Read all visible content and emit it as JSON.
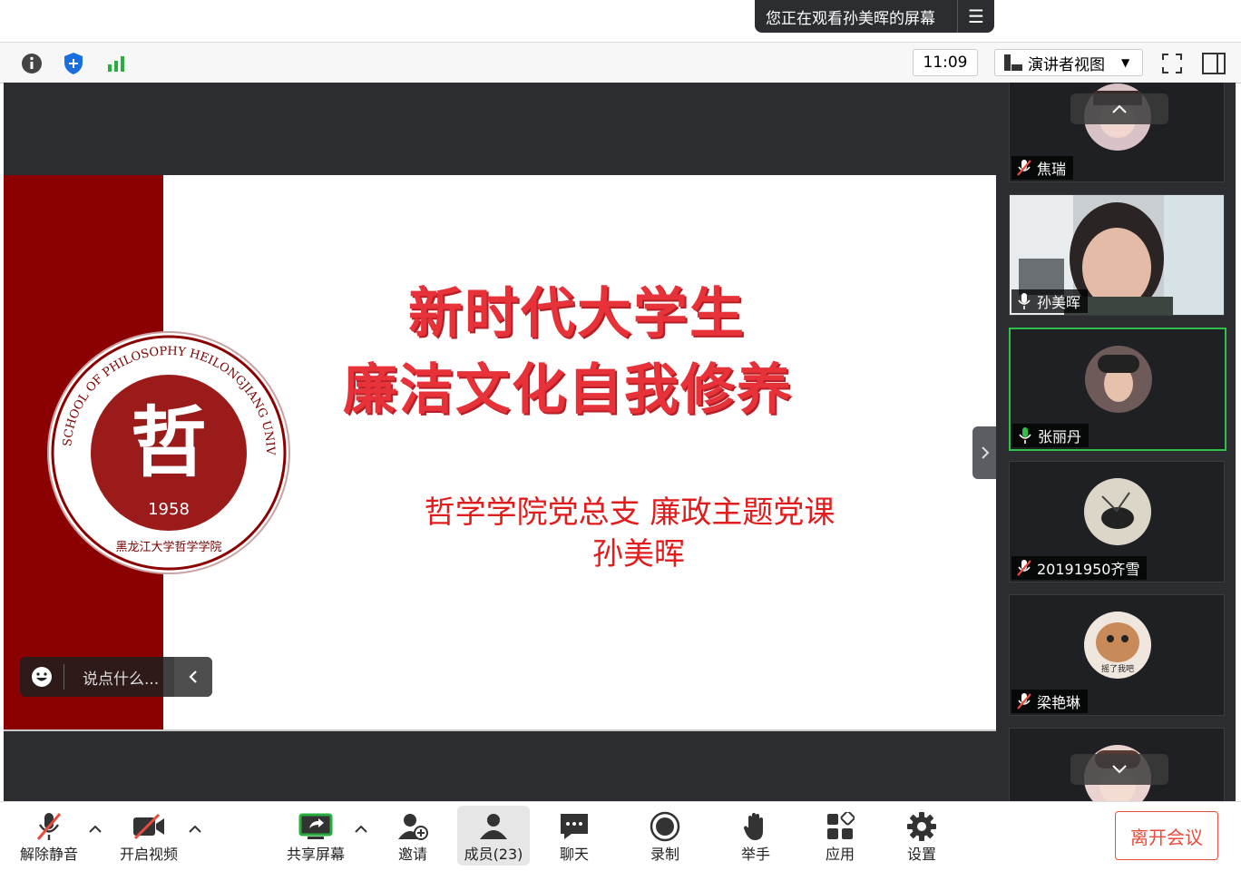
{
  "banner": {
    "text": "您正在观看孙美晖的屏幕"
  },
  "toolbar": {
    "time": "11:09",
    "view_label": "演讲者视图"
  },
  "slide": {
    "title_line1": "新时代大学生",
    "title_line2": "廉洁文化自我修养",
    "subtitle_line1": "哲学学院党总支 廉政主题党课",
    "subtitle_line2": "孙美晖",
    "logo_year": "1958",
    "logo_char": "哲",
    "logo_ring_text": "SCHOOL OF PHILOSOPHY HEILONGJIANG UNIVERSITY",
    "logo_bottom_text": "黑龙江大学哲学学院"
  },
  "chat": {
    "placeholder": "说点什么..."
  },
  "participants": [
    {
      "name": "焦瑞",
      "muted": true
    },
    {
      "name": "孙美晖",
      "muted": false
    },
    {
      "name": "张丽丹",
      "muted": false,
      "speaking": true
    },
    {
      "name": "20191950齐雪",
      "muted": true
    },
    {
      "name": "梁艳琳",
      "muted": true,
      "avatar_caption": "摇了我吧"
    }
  ],
  "bottom": {
    "unmute": "解除静音",
    "video": "开启视频",
    "share": "共享屏幕",
    "invite": "邀请",
    "members": "成员(23)",
    "chat": "聊天",
    "record": "录制",
    "raise_hand": "举手",
    "apps": "应用",
    "settings": "设置",
    "leave": "离开会议"
  },
  "colors": {
    "accent_red": "#e74c3c",
    "speaking_green": "#2fbf4a",
    "slide_red": "#e8323a",
    "strip": "#8b0000"
  }
}
